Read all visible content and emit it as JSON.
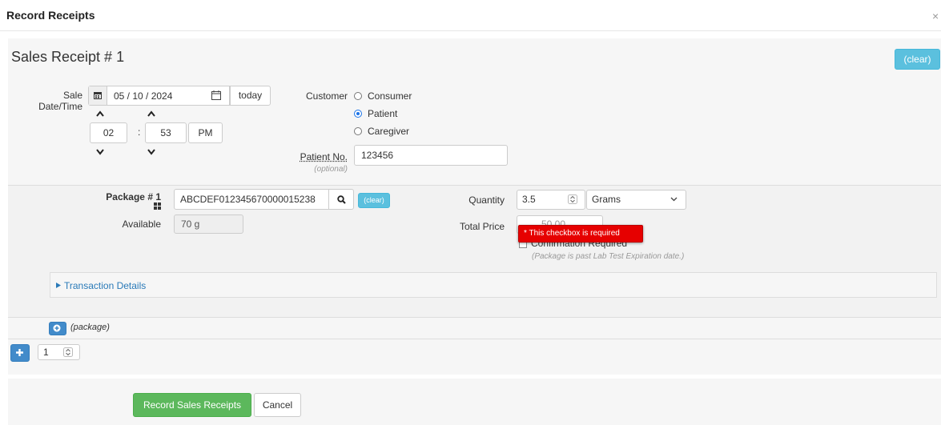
{
  "modal": {
    "title": "Record Receipts",
    "close": "×"
  },
  "receipt": {
    "title": "Sales Receipt # 1",
    "clear_label": "(clear)",
    "sale_label_line1": "Sale",
    "sale_label_line2": "Date/Time",
    "date_value": "05 / 10 / 2024",
    "today_label": "today",
    "hour": "02",
    "minute": "53",
    "time_sep": ":",
    "ampm": "PM",
    "customer_label": "Customer",
    "customer_options": [
      "Consumer",
      "Patient",
      "Caregiver"
    ],
    "customer_selected": "Patient",
    "patient_no_label": "Patient No.",
    "patient_no_optional": "(optional)",
    "patient_no_value": "123456"
  },
  "package": {
    "label": "Package # 1",
    "tag_value": "ABCDEF012345670000015238",
    "clear_label": "(clear)",
    "available_label": "Available",
    "available_value": "70 g",
    "quantity_label": "Quantity",
    "quantity_value": "3.5",
    "unit_value": "Grams",
    "total_price_label": "Total Price",
    "total_price_value": "50.00",
    "confirmation_label": "Confirmation Required",
    "expiration_note": "(Package is past Lab Test Expiration date.)",
    "validation_message": "* This checkbox is required",
    "transaction_details_label": "Transaction Details",
    "add_package_label": "(package)"
  },
  "receipt_count": {
    "value": "1"
  },
  "actions": {
    "record_label": "Record Sales Receipts",
    "cancel_label": "Cancel"
  },
  "colors": {
    "info": "#5bc0de",
    "primary": "#428bca",
    "success": "#5cb85c",
    "error": "#e60000",
    "link": "#2a7ab8"
  }
}
